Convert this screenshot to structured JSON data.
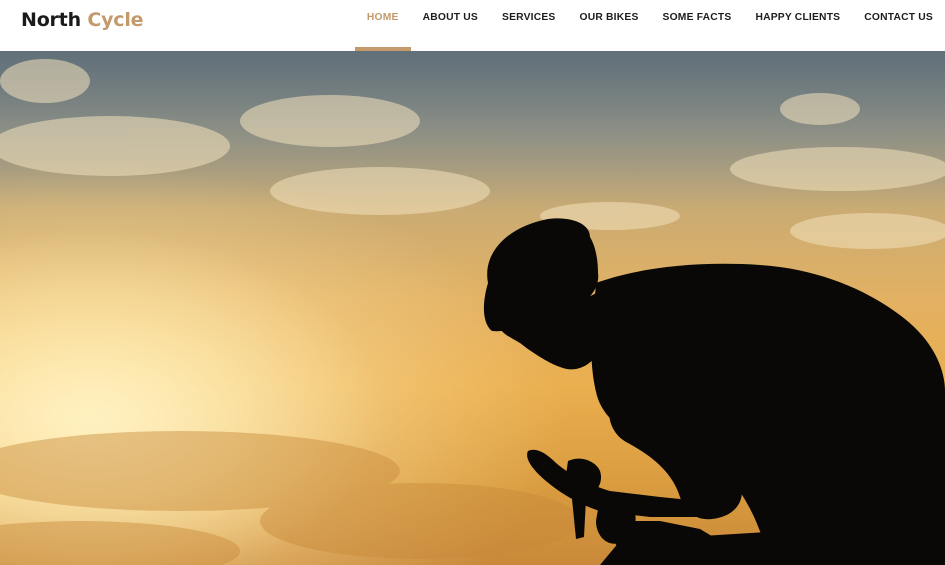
{
  "brand": {
    "name_part1": "North",
    "name_part2": "Cycle",
    "accent_color": "#c49a6c"
  },
  "nav": {
    "items": [
      {
        "label": "HOME",
        "active": true
      },
      {
        "label": "ABOUT US",
        "active": false
      },
      {
        "label": "SERVICES",
        "active": false
      },
      {
        "label": "OUR BIKES",
        "active": false
      },
      {
        "label": "SOME FACTS",
        "active": false
      },
      {
        "label": "HAPPY CLIENTS",
        "active": false
      },
      {
        "label": "CONTACT US",
        "active": false
      }
    ]
  },
  "hero": {
    "image": "cyclist-silhouette-sunset"
  }
}
